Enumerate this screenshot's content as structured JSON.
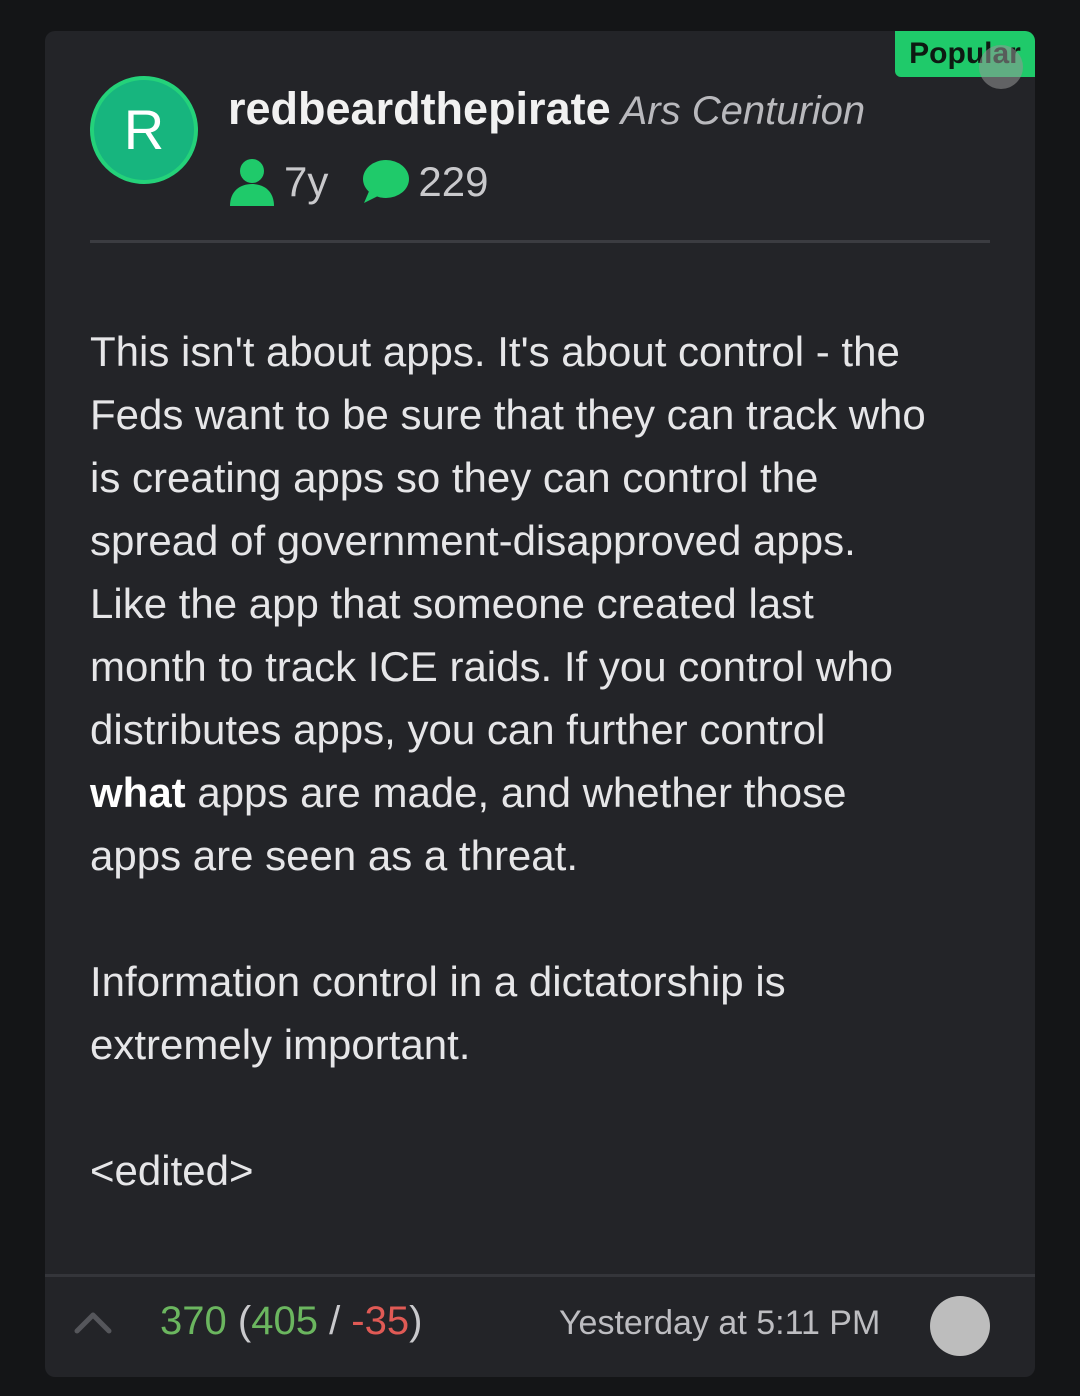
{
  "badge": {
    "label": "Popular"
  },
  "author": {
    "avatar_letter": "R",
    "username": "redbeardthepirate",
    "title": "Ars Centurion",
    "membership": "7y",
    "post_count": "229"
  },
  "post": {
    "paragraph1": {
      "lines": [
        "This isn't about apps. It's about control - the",
        "Feds want to be sure that they can track who",
        "is creating apps so they can control the",
        "spread of government-disapproved apps.",
        "Like the app that someone created last",
        "month to track ICE raids. If you control who",
        "distributes apps, you can further control"
      ],
      "bold_word": "what",
      "after_bold": " apps are made, and whether those",
      "last_line": "apps are seen as a threat."
    },
    "paragraph2": {
      "line1": "Information control in a dictatorship is",
      "line2": "extremely important."
    },
    "paragraph3": "<edited>"
  },
  "footer": {
    "score": "370",
    "upvotes": "405",
    "downvotes": "-35",
    "open_paren": "(",
    "separator": " / ",
    "close_paren": ")",
    "timestamp": "Yesterday at 5:11 PM"
  },
  "colors": {
    "accent": "#1fca6a",
    "positive": "#6bb65f",
    "negative": "#e05a55",
    "card_bg": "#232428",
    "page_bg": "#141517"
  }
}
